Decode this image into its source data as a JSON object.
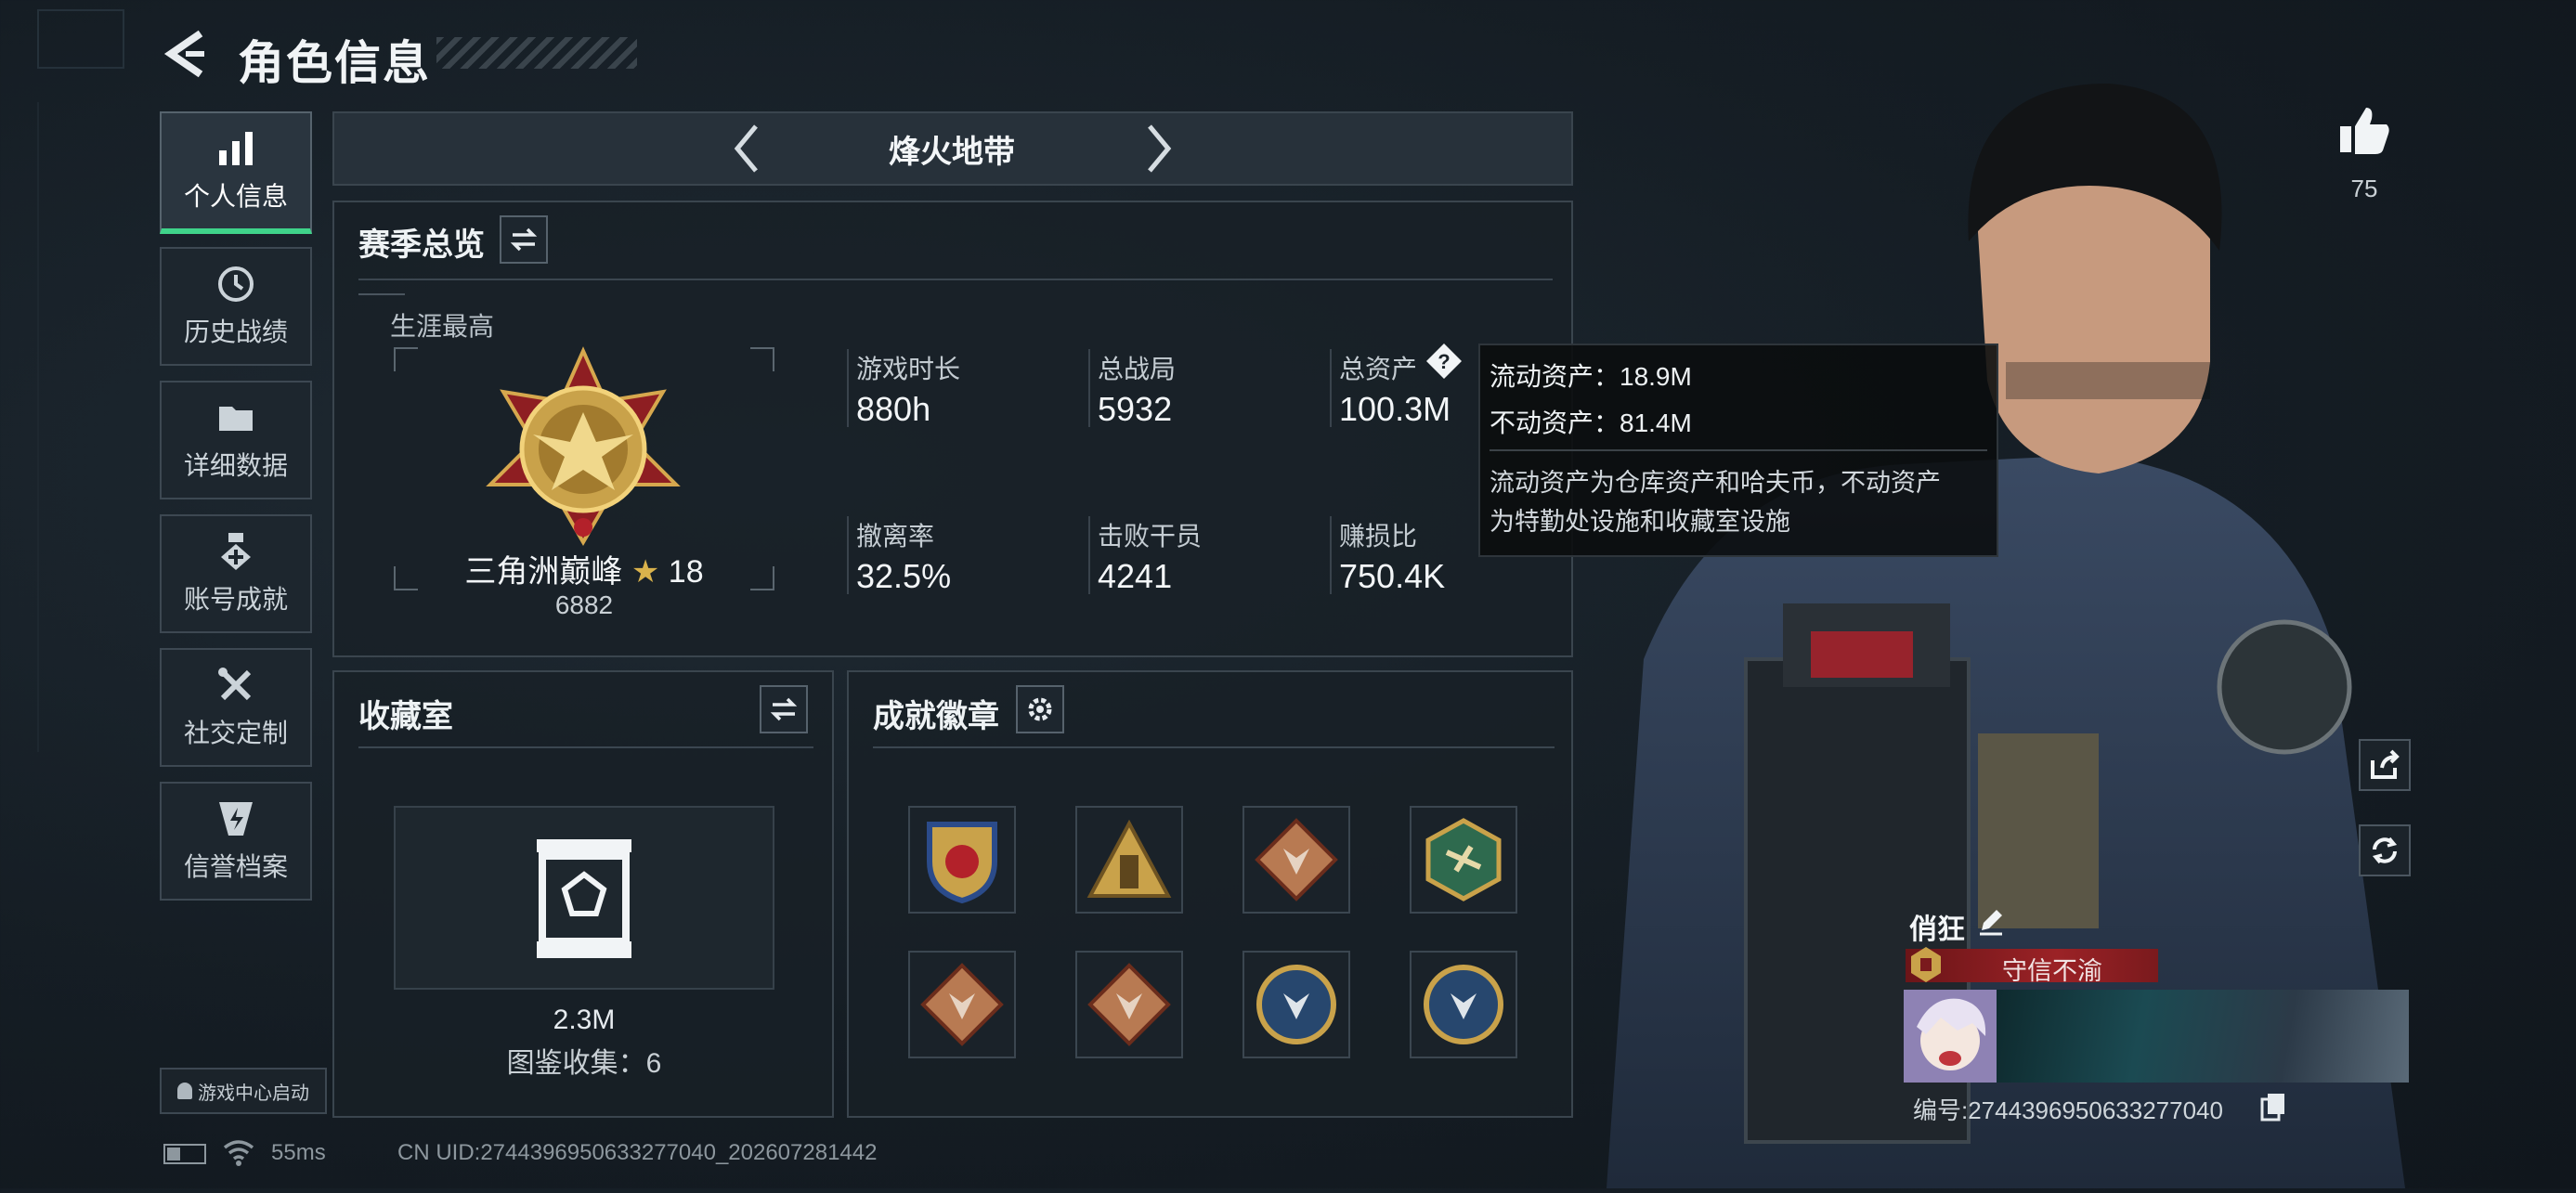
{
  "header": {
    "title": "角色信息"
  },
  "sidebar": {
    "items": [
      {
        "label": "个人信息",
        "active": true
      },
      {
        "label": "历史战绩"
      },
      {
        "label": "详细数据"
      },
      {
        "label": "账号成就"
      },
      {
        "label": "社交定制"
      },
      {
        "label": "信誉档案"
      }
    ],
    "game_center": "游戏中心启动"
  },
  "mode_selector": {
    "current": "烽火地带"
  },
  "season": {
    "title": "赛季总览",
    "career_best_label": "生涯最高",
    "rank_name": "三角洲巅峰",
    "rank_stars": "18",
    "rank_points": "6882",
    "stats": [
      {
        "label": "游戏时长",
        "value": "880h"
      },
      {
        "label": "总战局",
        "value": "5932"
      },
      {
        "label": "总资产",
        "value": "100.3M"
      },
      {
        "label": "撤离率",
        "value": "32.5%"
      },
      {
        "label": "击败干员",
        "value": "4241"
      },
      {
        "label": "赚损比",
        "value": "750.4K"
      }
    ]
  },
  "tooltip": {
    "line1": "流动资产：18.9M",
    "line2": "不动资产：81.4M",
    "desc1": "流动资产为仓库资产和哈夫币，不动资产",
    "desc2": "为特勤处设施和收藏室设施"
  },
  "collection": {
    "title": "收藏室",
    "value": "2.3M",
    "count_text": "图鉴收集：6"
  },
  "badges": {
    "title": "成就徽章"
  },
  "profile": {
    "likes": "75",
    "nickname": "俏狂",
    "motto": "守信不渝",
    "id_text": "编号:2744396950633277040"
  },
  "status_bar": {
    "ping": "55ms",
    "uid": "CN UID:2744396950633277040_202607281442"
  },
  "colors": {
    "accent_green": "#3fd38a",
    "motto_red": "#8b1c1f",
    "gold": "#c9a24a"
  }
}
